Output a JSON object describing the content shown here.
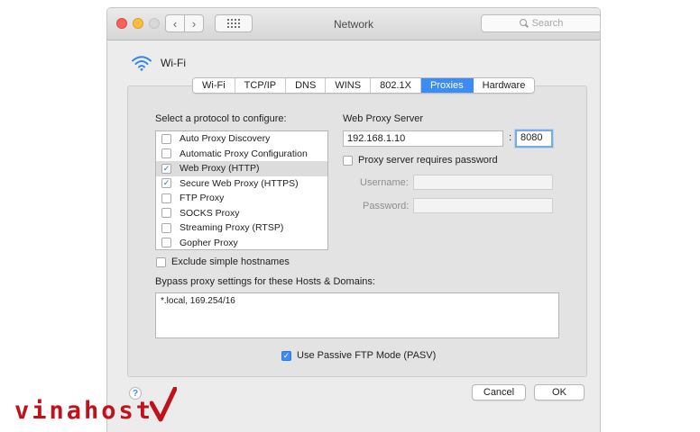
{
  "window": {
    "title": "Network",
    "search_placeholder": "Search"
  },
  "interface": {
    "name": "Wi-Fi",
    "icon": "wifi-icon"
  },
  "tabs": [
    {
      "label": "Wi-Fi",
      "active": false
    },
    {
      "label": "TCP/IP",
      "active": false
    },
    {
      "label": "DNS",
      "active": false
    },
    {
      "label": "WINS",
      "active": false
    },
    {
      "label": "802.1X",
      "active": false
    },
    {
      "label": "Proxies",
      "active": true
    },
    {
      "label": "Hardware",
      "active": false
    }
  ],
  "protocols": {
    "heading": "Select a protocol to configure:",
    "items": [
      {
        "label": "Auto Proxy Discovery",
        "checked": false,
        "selected": false
      },
      {
        "label": "Automatic Proxy Configuration",
        "checked": false,
        "selected": false
      },
      {
        "label": "Web Proxy (HTTP)",
        "checked": true,
        "selected": true
      },
      {
        "label": "Secure Web Proxy (HTTPS)",
        "checked": true,
        "selected": false
      },
      {
        "label": "FTP Proxy",
        "checked": false,
        "selected": false
      },
      {
        "label": "SOCKS Proxy",
        "checked": false,
        "selected": false
      },
      {
        "label": "Streaming Proxy (RTSP)",
        "checked": false,
        "selected": false
      },
      {
        "label": "Gopher Proxy",
        "checked": false,
        "selected": false
      }
    ]
  },
  "proxy_server": {
    "heading": "Web Proxy Server",
    "host": "192.168.1.10",
    "separator": ":",
    "port": "8080",
    "requires_password_label": "Proxy server requires password",
    "requires_password": false,
    "username_label": "Username:",
    "username": "",
    "password_label": "Password:",
    "password": ""
  },
  "exclude_simple_hostnames": {
    "label": "Exclude simple hostnames",
    "checked": false
  },
  "bypass": {
    "heading": "Bypass proxy settings for these Hosts & Domains:",
    "value": "*.local, 169.254/16"
  },
  "passive_ftp": {
    "label": "Use Passive FTP Mode (PASV)",
    "checked": true
  },
  "buttons": {
    "help": "?",
    "cancel": "Cancel",
    "ok": "OK"
  },
  "watermark": {
    "text": "vinahost",
    "logo": "checkmark-logo"
  },
  "colors": {
    "accent": "#3b8cf4",
    "watermark": "#c0121a"
  }
}
